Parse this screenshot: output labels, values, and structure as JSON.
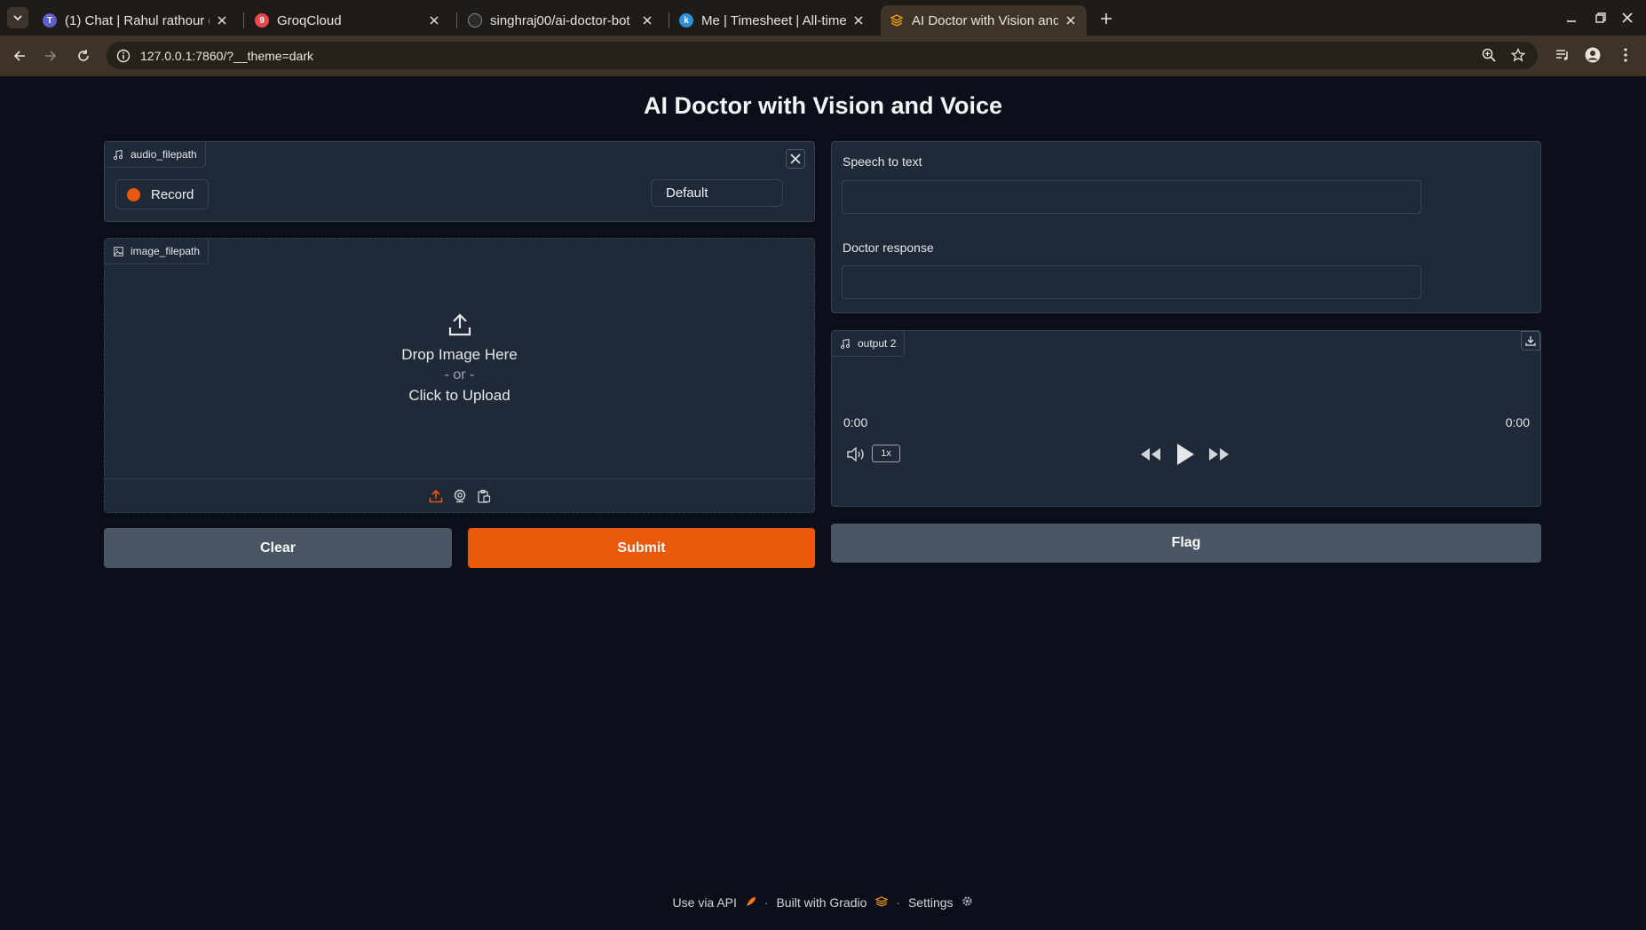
{
  "browser": {
    "tabs": [
      {
        "title": "(1) Chat | Rahul rathour (",
        "favicon": "teams-icon",
        "active": false
      },
      {
        "title": "GroqCloud",
        "favicon": "groq-icon",
        "active": false
      },
      {
        "title": "singhraj00/ai-doctor-bot",
        "favicon": "github-icon",
        "active": false
      },
      {
        "title": "Me | Timesheet | All-time",
        "favicon": "timesheet-icon",
        "active": false
      },
      {
        "title": "AI Doctor with Vision and",
        "favicon": "gradio-icon",
        "active": true
      }
    ],
    "url": "127.0.0.1:7860/?__theme=dark",
    "groq_badge": "9"
  },
  "app": {
    "title": "AI Doctor with Vision and Voice",
    "audio_input": {
      "label": "audio_filepath",
      "record_label": "Record",
      "device": "Default"
    },
    "image_input": {
      "label": "image_filepath",
      "drop_text": "Drop Image Here",
      "or_text": "- or -",
      "click_text": "Click to Upload"
    },
    "buttons": {
      "clear": "Clear",
      "submit": "Submit",
      "flag": "Flag"
    },
    "outputs": {
      "speech_label": "Speech to text",
      "speech_value": "",
      "doctor_label": "Doctor response",
      "doctor_value": ""
    },
    "audio_output": {
      "label": "output 2",
      "current_time": "0:00",
      "duration": "0:00",
      "speed": "1x"
    },
    "footer": {
      "api": "Use via API",
      "built": "Built with Gradio",
      "settings": "Settings",
      "dot": "·"
    }
  },
  "colors": {
    "accent": "#ea580c",
    "background": "#0b0f19",
    "panel": "#1f2937",
    "border": "#374151"
  }
}
